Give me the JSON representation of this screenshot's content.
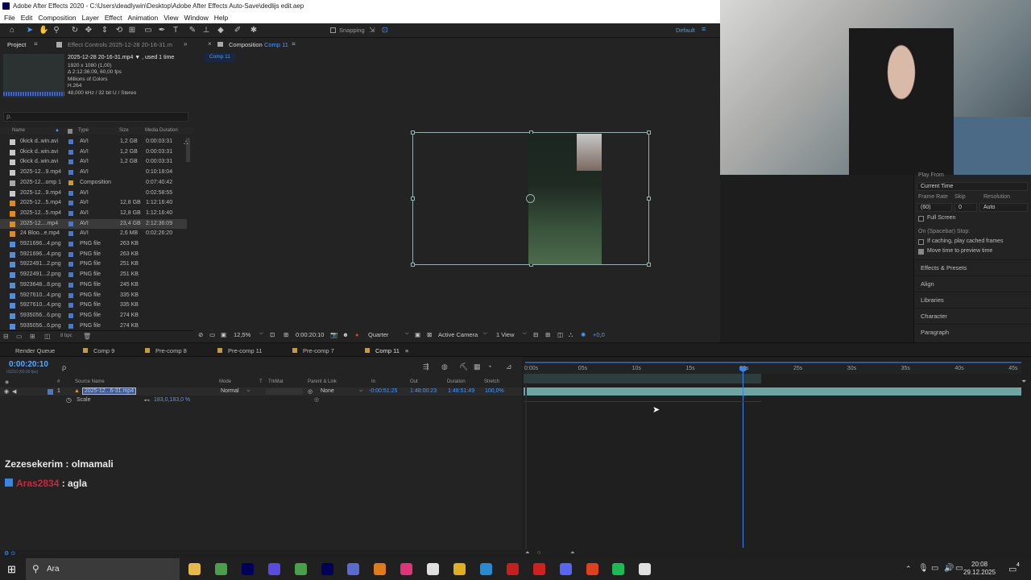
{
  "window": {
    "title": "Adobe After Effects 2020 - C:\\Users\\deadlywin\\Desktop\\Adobe After Effects Auto-Save\\dedlijs edit.aep"
  },
  "menu": [
    "File",
    "Edit",
    "Composition",
    "Layer",
    "Effect",
    "Animation",
    "View",
    "Window",
    "Help"
  ],
  "toolbar": {
    "snapping": "Snapping",
    "workspace": "Default"
  },
  "project": {
    "tab_project": "Project",
    "tab_effects": "Effect Controls 2025-12-28 20-16-31.m",
    "file_name": "2025-12-28 20-16-31.mp4 ▼ , used 1 time",
    "file_info": [
      "1920 x 1080 (1,00)",
      "Δ 2:12:36:09, 60,00 fps",
      "Millions of Colors",
      "H.264",
      "48,000 kHz / 32 bit U / Stereo"
    ],
    "search_placeholder": "ρ.",
    "columns": {
      "name": "Name",
      "type": "Type",
      "size": "Size",
      "duration": "Media Duration"
    },
    "files": [
      {
        "name": "0kick d..win.avi",
        "type": "AVI",
        "size": "1,2 GB",
        "duration": "0:00:03:31",
        "label": "#4a78c8"
      },
      {
        "name": "0kick d..win.avi",
        "type": "AVI",
        "size": "1,2 GB",
        "duration": "0:00:03:31",
        "label": "#4a78c8"
      },
      {
        "name": "0kick d..win.avi",
        "type": "AVI",
        "size": "1,2 GB",
        "duration": "0:00:03:31",
        "label": "#4a78c8"
      },
      {
        "name": "2025-12...9.mp4",
        "type": "AVI",
        "size": "",
        "duration": "0:10:18:04",
        "label": "#4a78c8"
      },
      {
        "name": "2025-12...omp 1",
        "type": "Composition",
        "size": "",
        "duration": "0:07:40:42",
        "label": "#c89a3a"
      },
      {
        "name": "2025-12...9.mp4",
        "type": "AVI",
        "size": "",
        "duration": "0:02:58:55",
        "label": "#4a78c8"
      },
      {
        "name": "2025-12...5.mp4",
        "type": "AVI",
        "size": "12,8 GB",
        "duration": "1:12:16:40",
        "label": "#4a78c8"
      },
      {
        "name": "2025-12...5.mp4",
        "type": "AVI",
        "size": "12,8 GB",
        "duration": "1:12:16:40",
        "label": "#4a78c8"
      },
      {
        "name": "2025-12....mp4",
        "type": "AVI",
        "size": "23,4 GB",
        "duration": "2:12:36:09",
        "label": "#4a78c8"
      },
      {
        "name": "24 Bloo...e.mp4",
        "type": "AVI",
        "size": "2,6 MB",
        "duration": "0:02:26:20",
        "label": "#4a78c8"
      },
      {
        "name": "5921696...4.png",
        "type": "PNG file",
        "size": "263 KB",
        "duration": "",
        "label": "#4a78c8"
      },
      {
        "name": "5921696...4.png",
        "type": "PNG file",
        "size": "263 KB",
        "duration": "",
        "label": "#4a78c8"
      },
      {
        "name": "5922491...2.png",
        "type": "PNG file",
        "size": "251 KB",
        "duration": "",
        "label": "#4a78c8"
      },
      {
        "name": "5922491...2.png",
        "type": "PNG file",
        "size": "251 KB",
        "duration": "",
        "label": "#4a78c8"
      },
      {
        "name": "5923648...8.png",
        "type": "PNG file",
        "size": "245 KB",
        "duration": "",
        "label": "#4a78c8"
      },
      {
        "name": "5927610...4.png",
        "type": "PNG file",
        "size": "335 KB",
        "duration": "",
        "label": "#4a78c8"
      },
      {
        "name": "5927610...4.png",
        "type": "PNG file",
        "size": "335 KB",
        "duration": "",
        "label": "#4a78c8"
      },
      {
        "name": "5935056...6.png",
        "type": "PNG file",
        "size": "274 KB",
        "duration": "",
        "label": "#4a78c8"
      },
      {
        "name": "5935056...6.png",
        "type": "PNG file",
        "size": "274 KB",
        "duration": "",
        "label": "#4a78c8"
      }
    ],
    "bpc": "8 bpc"
  },
  "composition": {
    "tab_label": "Composition",
    "tab_name": "Comp 11",
    "breadcrumb": "Comp 11",
    "zoom": "12,5%",
    "timecode": "0:00:20:10",
    "resolution": "Quarter",
    "camera": "Active Camera",
    "views": "1 View",
    "exposure": "+0,0"
  },
  "preview": {
    "play_from_label": "Play From",
    "play_from": "Current Time",
    "frame_rate_label": "Frame Rate",
    "skip_label": "Skip",
    "resolution_label": "Resolution",
    "frame_rate": "(60)",
    "skip": "0",
    "resolution": "Auto",
    "full_screen": "Full Screen",
    "on_spacebar": "On (Spacebar) Stop:",
    "if_caching": "If caching, play cached frames",
    "move_time": "Move time to preview time",
    "sections": [
      "Effects & Presets",
      "Align",
      "Libraries",
      "Character",
      "Paragraph"
    ]
  },
  "timeline": {
    "tabs": [
      "Render Queue",
      "Comp 9",
      "Pre-comp 8",
      "Pre-comp 11",
      "Pre-comp 7",
      "Comp 11"
    ],
    "timecode": "0:00:20:10",
    "timecode_sub": "01210 (60.00 fps)",
    "headers": {
      "source": "Source Name",
      "mode": "Mode",
      "t": "T",
      "trkmat": "TrkMat",
      "parent": "Parent & Link",
      "in": "In",
      "out": "Out",
      "duration": "Duration",
      "stretch": "Stretch"
    },
    "layer": {
      "num": "1",
      "name": "2025-12...6-31.mp4",
      "mode": "Normal",
      "parent": "None",
      "in": "-0:00:51:25",
      "out": "1:48:00:23",
      "duration": "1:48:51:49",
      "stretch": "100,0%"
    },
    "prop": {
      "name": "Scale",
      "value": "183,0,183,0 %"
    },
    "ruler": [
      "0:00s",
      "05s",
      "10s",
      "15s",
      "20s",
      "25s",
      "30s",
      "35s",
      "40s",
      "45s"
    ]
  },
  "chat": [
    {
      "user": "Zezesekerim",
      "msg": " : olmamali",
      "color": "#e8e8e8"
    },
    {
      "user": "Aras2834",
      "msg": " : agla",
      "color": "#c8283c"
    }
  ],
  "taskbar": {
    "search": "Ara",
    "time": "20:08",
    "date": "29.12.2025",
    "notif": "4",
    "apps": [
      "#e7b84a",
      "#4aa04a",
      "#00005b",
      "#5a4ae0",
      "#4aa04a",
      "#00005b",
      "#5a6ad0",
      "#e07a1a",
      "#e0347a",
      "#e0e0e0",
      "#e0b020",
      "#2a8ad0",
      "#c81e1e",
      "#d02020",
      "#5865f2",
      "#e04020",
      "#1db954",
      "#e0e0e0"
    ]
  }
}
